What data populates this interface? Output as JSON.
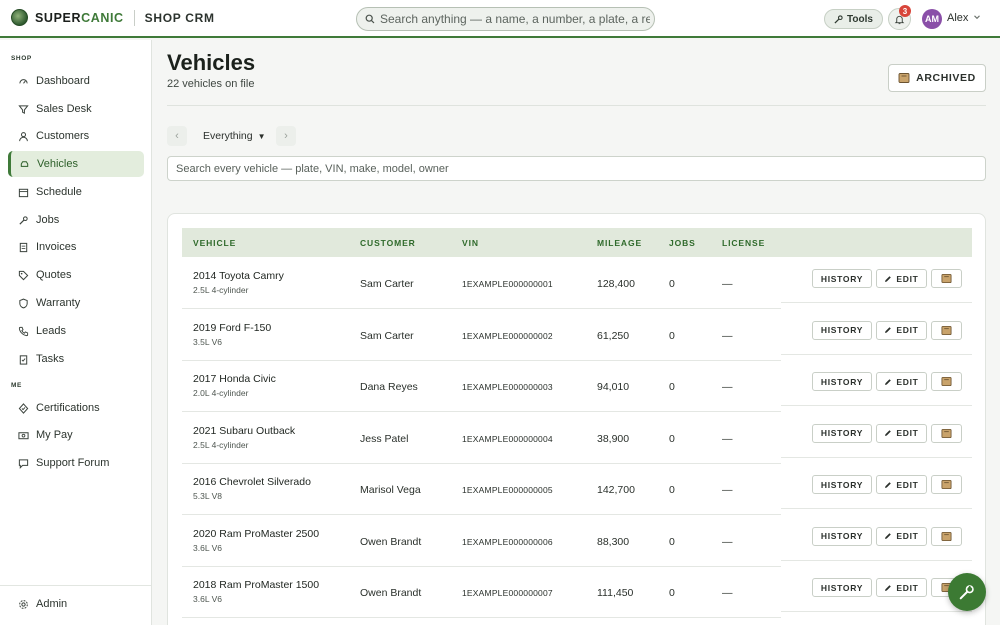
{
  "brand": {
    "name_prefix": "SUPER",
    "name_accent": "CANIC",
    "product": "SHOP CRM"
  },
  "search": {
    "placeholder": "Search anything — a name, a number, a plate, a repair"
  },
  "header": {
    "tools_label": "Tools",
    "notifications_count": "3",
    "avatar_initials": "AM",
    "user_name": "Alex"
  },
  "sidebar": {
    "shop_label": "SHOP",
    "me_label": "ME",
    "items": [
      {
        "label": "Dashboard",
        "icon": "gauge-icon"
      },
      {
        "label": "Sales Desk",
        "icon": "funnel-icon"
      },
      {
        "label": "Customers",
        "icon": "person-icon"
      },
      {
        "label": "Vehicles",
        "icon": "car-icon"
      },
      {
        "label": "Schedule",
        "icon": "calendar-icon"
      },
      {
        "label": "Jobs",
        "icon": "wrench-icon"
      },
      {
        "label": "Invoices",
        "icon": "receipt-icon"
      },
      {
        "label": "Quotes",
        "icon": "tag-icon"
      },
      {
        "label": "Warranty",
        "icon": "shield-icon"
      },
      {
        "label": "Leads",
        "icon": "phone-icon"
      },
      {
        "label": "Tasks",
        "icon": "clipboard-icon"
      }
    ],
    "me_items": [
      {
        "label": "Certifications",
        "icon": "badge-icon"
      },
      {
        "label": "My Pay",
        "icon": "money-icon"
      },
      {
        "label": "Support Forum",
        "icon": "chat-icon"
      }
    ],
    "admin_label": "Admin"
  },
  "page": {
    "title": "Vehicles",
    "subtitle": "22 vehicles on file",
    "archived_label": "ARCHIVED",
    "filter_value": "Everything",
    "vehicle_search_placeholder": "Search every vehicle — plate, VIN, make, model, owner"
  },
  "table": {
    "headers": {
      "vehicle": "VEHICLE",
      "customer": "CUSTOMER",
      "vin": "VIN",
      "mileage": "MILEAGE",
      "jobs": "JOBS",
      "license": "LICENSE"
    },
    "history_label": "HISTORY",
    "edit_label": "EDIT",
    "rows": [
      {
        "name": "2014 Toyota Camry",
        "engine": "2.5L 4-cylinder",
        "customer": "Sam Carter",
        "vin": "1EXAMPLE000000001",
        "mileage": "128,400",
        "jobs": "0",
        "license": "—"
      },
      {
        "name": "2019 Ford F-150",
        "engine": "3.5L V6",
        "customer": "Sam Carter",
        "vin": "1EXAMPLE000000002",
        "mileage": "61,250",
        "jobs": "0",
        "license": "—"
      },
      {
        "name": "2017 Honda Civic",
        "engine": "2.0L 4-cylinder",
        "customer": "Dana Reyes",
        "vin": "1EXAMPLE000000003",
        "mileage": "94,010",
        "jobs": "0",
        "license": "—"
      },
      {
        "name": "2021 Subaru Outback",
        "engine": "2.5L 4-cylinder",
        "customer": "Jess Patel",
        "vin": "1EXAMPLE000000004",
        "mileage": "38,900",
        "jobs": "0",
        "license": "—"
      },
      {
        "name": "2016 Chevrolet Silverado",
        "engine": "5.3L V8",
        "customer": "Marisol Vega",
        "vin": "1EXAMPLE000000005",
        "mileage": "142,700",
        "jobs": "0",
        "license": "—"
      },
      {
        "name": "2020 Ram ProMaster 2500",
        "engine": "3.6L V6",
        "customer": "Owen Brandt",
        "vin": "1EXAMPLE000000006",
        "mileage": "88,300",
        "jobs": "0",
        "license": "—"
      },
      {
        "name": "2018 Ram ProMaster 1500",
        "engine": "3.6L V6",
        "customer": "Owen Brandt",
        "vin": "1EXAMPLE000000007",
        "mileage": "111,450",
        "jobs": "0",
        "license": "—"
      }
    ]
  },
  "colors": {
    "accent": "#3f7a39",
    "header_bg": "#e1e9dc",
    "badge": "#d8453a",
    "avatar": "#8a4fa8"
  }
}
